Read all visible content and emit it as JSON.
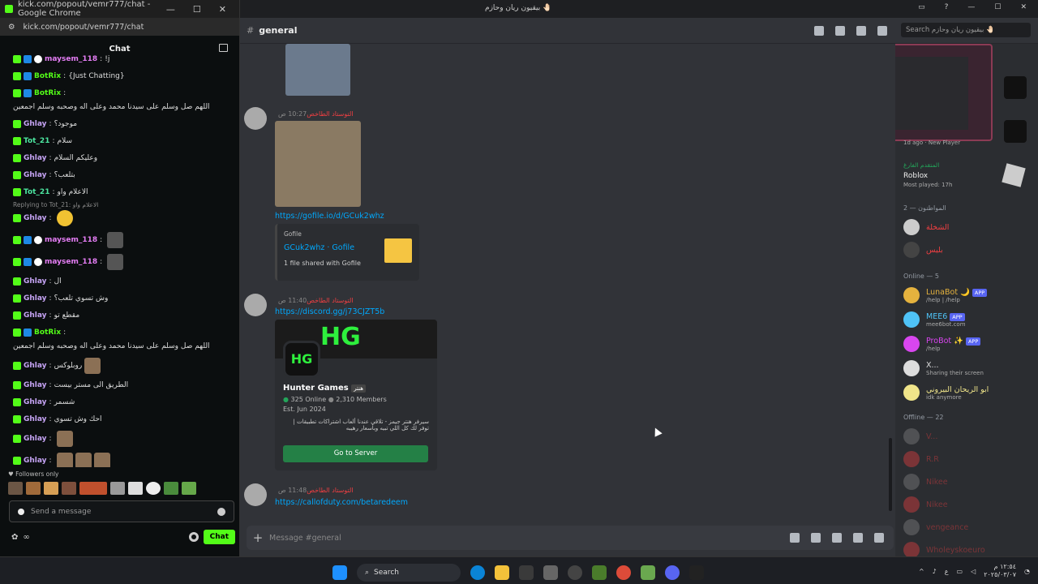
{
  "kick": {
    "window_title": "kick.com/popout/vemr777/chat - Google Chrome",
    "url": "kick.com/popout/vemr777/chat",
    "header": "Chat",
    "messages": [
      {
        "user": "maysem_118",
        "text": "!j",
        "badges": 3
      },
      {
        "user": "BotRix",
        "text": "{Just Chatting}",
        "bot": true
      },
      {
        "user": "BotRix",
        "text": "اللهم صل وسلم على سيدنا محمد وعلى اله وصحبه وسلم اجمعين",
        "bot": true
      },
      {
        "user": "Ghlay",
        "text": "موجود؟"
      },
      {
        "user": "Tot_21",
        "text": "سلام"
      },
      {
        "user": "Ghlay",
        "text": "وعليكم السلام"
      },
      {
        "user": "Ghlay",
        "text": "بتلعب؟"
      },
      {
        "user": "Tot_21",
        "text": "الاعلام واو"
      },
      {
        "user": "Ghlay",
        "text": "",
        "emote": "y",
        "reply": "Replying to Tot_21: الاعلام واو"
      },
      {
        "user": "maysem_118",
        "text": "",
        "emote": "g",
        "badges": 3
      },
      {
        "user": "maysem_118",
        "text": "",
        "emote": "g",
        "badges": 3
      },
      {
        "user": "Ghlay",
        "text": "ال"
      },
      {
        "user": "Ghlay",
        "text": "وش تسوي تلعب؟"
      },
      {
        "user": "Ghlay",
        "text": "مقطع تو"
      },
      {
        "user": "BotRix",
        "text": "اللهم صل وسلم على سيدنا محمد وعلى اله وصحبه وسلم اجمعين",
        "bot": true
      },
      {
        "user": "Ghlay",
        "text": "روبلوكس",
        "emote": "b"
      },
      {
        "user": "Ghlay",
        "text": "الطريق الى مستر بيست"
      },
      {
        "user": "Ghlay",
        "text": "شسمر"
      },
      {
        "user": "Ghlay",
        "text": "احك وش تسوي"
      },
      {
        "user": "Ghlay",
        "text": "",
        "emote": "b"
      },
      {
        "user": "Ghlay",
        "text": "",
        "emote": "bbb"
      }
    ],
    "followers_only": "Followers only",
    "input_placeholder": "Send a message",
    "chat_button": "Chat",
    "bottom_label": "∞"
  },
  "discord": {
    "window_title": "بيقيون ريان وحازم 🤚🏻",
    "channel": "general",
    "search_placeholder": "Search بيقيون ريان وحازم 🤚🏻",
    "posts": [
      {
        "author": "التوستاد الطاخص",
        "time": "10:27 ص",
        "link": "https://gofile.io/d/GCuk2whz",
        "embed": {
          "provider": "Gofile",
          "title": "GCuk2whz · Gofile",
          "desc": "1 file shared with Gofile"
        }
      },
      {
        "author": "التوستاد الطاخص",
        "time": "11:40 ص",
        "link": "https://discord.gg/j73CJZT5b",
        "invite": {
          "name": "Hunter Games",
          "tag": "هنتر",
          "online": "325 Online",
          "members": "2,310 Members",
          "est": "Est. Jun 2024",
          "desc": "سيرفر هنتر جيمز - تلاقي عندنا ألعاب اشتراكات تطبيقات | توفر لك كل اللي تبيه وبأسعار رهيبه",
          "button": "Go to Server"
        }
      },
      {
        "author": "التوستاد الطاخص",
        "time": "11:48 ص",
        "link": "https://callofduty.com/betaredeem"
      }
    ],
    "composer_placeholder": "Message #general",
    "members_panel": {
      "activity": {
        "time": "1d ago",
        "label": "New Player",
        "user": "المتقدم الفارغ",
        "game": "Roblox",
        "played": "Most played: 17h"
      },
      "group1_header": "المواطنون — 2",
      "group1": [
        {
          "name": "الشخلة"
        },
        {
          "name": "بليس"
        }
      ],
      "online_header": "Online — 5",
      "online": [
        {
          "name": "LunaBot 🌙",
          "sub": "/help | /help",
          "app": "APP",
          "color": "#e5b23e"
        },
        {
          "name": "MEE6",
          "sub": "mee6bot.com",
          "app": "APP",
          "color": "#4fc3f7"
        },
        {
          "name": "ProBot ✨",
          "sub": "/help",
          "app": "APP",
          "color": "#d946ef"
        },
        {
          "name": "X...",
          "sub": "Sharing their screen",
          "color": "#ddd"
        },
        {
          "name": "ابو الريحان البيروني",
          "sub": "idk anymore",
          "color": "#f0e58a"
        }
      ],
      "offline_header": "Offline — 22",
      "offline": [
        {
          "name": "V..."
        },
        {
          "name": "R.R"
        },
        {
          "name": "Nikee"
        },
        {
          "name": "Nikee"
        },
        {
          "name": "vengeance"
        },
        {
          "name": "Wholeyskoeuro"
        }
      ]
    }
  },
  "taskbar": {
    "search": "Search",
    "time": "١٢:٥٤ م",
    "date": "٢٠٢٥/٠٣/٠٧",
    "lang": "ع"
  }
}
